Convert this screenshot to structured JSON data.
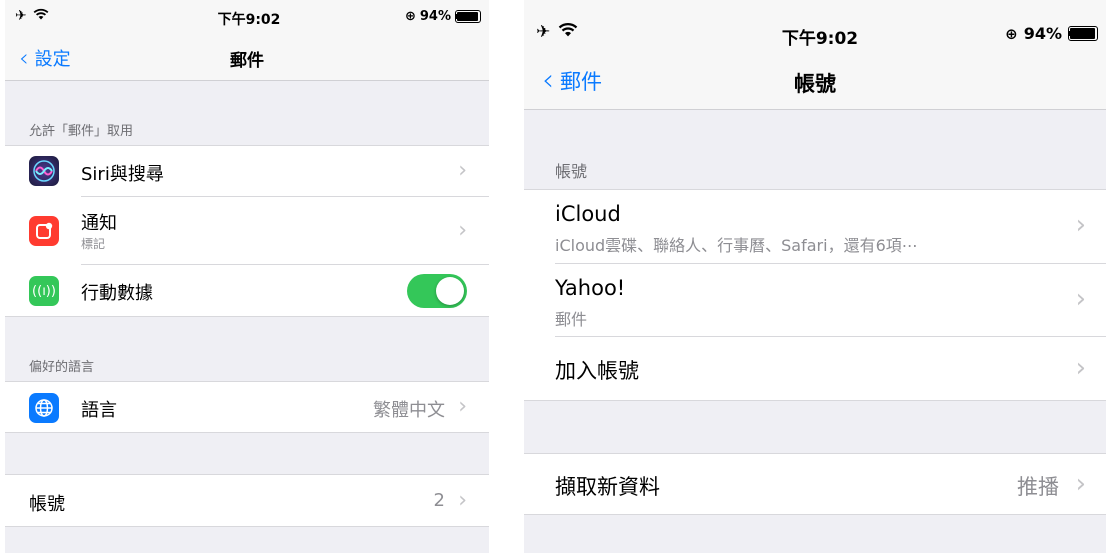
{
  "left": {
    "status": {
      "time": "下午9:02",
      "battery": "94%"
    },
    "nav": {
      "back_label": "設定",
      "title": "郵件"
    },
    "section_allow": {
      "header": "允許「郵件」取用",
      "rows": [
        {
          "label": "Siri與搜尋"
        },
        {
          "label": "通知",
          "subtitle": "標記"
        },
        {
          "label": "行動數據",
          "toggle_on": true
        }
      ]
    },
    "section_lang": {
      "header": "偏好的語言",
      "rows": [
        {
          "label": "語言",
          "detail": "繁體中文"
        }
      ]
    },
    "section_accounts": {
      "rows": [
        {
          "label": "帳號",
          "detail": "2"
        }
      ]
    }
  },
  "right": {
    "status": {
      "time": "下午9:02",
      "battery": "94%"
    },
    "nav": {
      "back_label": "郵件",
      "title": "帳號"
    },
    "section_accounts": {
      "header": "帳號",
      "rows": [
        {
          "label": "iCloud",
          "subtitle": "iCloud雲碟、聯絡人、行事曆、Safari，還有6項⋯"
        },
        {
          "label": "Yahoo!",
          "subtitle": "郵件"
        },
        {
          "label": "加入帳號"
        }
      ]
    },
    "section_fetch": {
      "rows": [
        {
          "label": "擷取新資料",
          "detail": "推播"
        }
      ]
    }
  },
  "colors": {
    "accent": "#0a7aff",
    "toggle_on": "#34c759",
    "background": "#efeff4"
  },
  "icons": {
    "siri": "siri-icon",
    "notifications": "notifications-icon",
    "cellular": "cellular-antenna-icon",
    "language": "globe-icon"
  }
}
